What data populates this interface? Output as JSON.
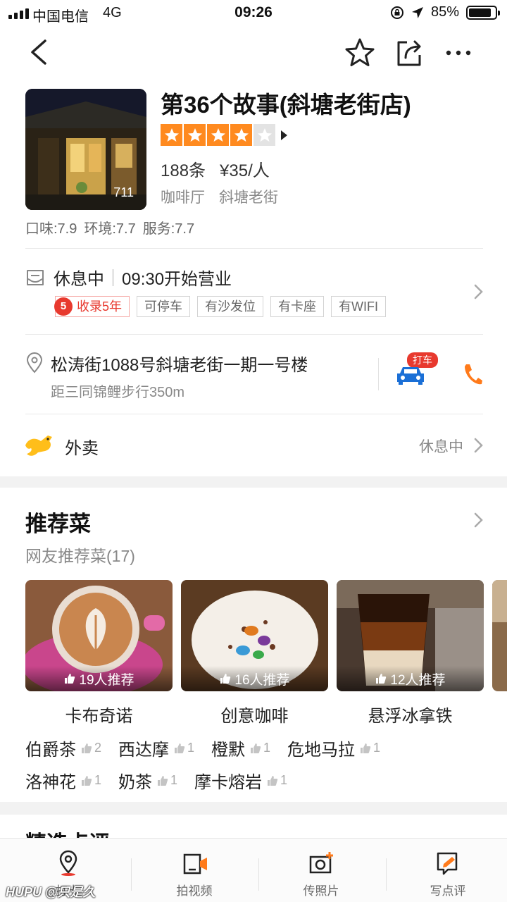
{
  "status_bar": {
    "carrier": "中国电信",
    "network": "4G",
    "time": "09:26",
    "battery": "85%",
    "battery_level": 0.85
  },
  "shop": {
    "name": "第36个故事(斜塘老街店)",
    "photo_count": "711",
    "rating_stars": 4,
    "reviews": "188条",
    "price": "¥35/人",
    "category": "咖啡厅",
    "area": "斜塘老街",
    "scores": [
      "口味:7.9",
      "环境:7.7",
      "服务:7.7"
    ]
  },
  "hours": {
    "status": "休息中",
    "open_info": "09:30开始营业",
    "badge_number": "5",
    "tags": [
      "收录5年",
      "可停车",
      "有沙发位",
      "有卡座",
      "有WIFI"
    ]
  },
  "address": {
    "text": "松涛街1088号斜塘老街一期一号楼",
    "distance": "距三同锦鲤步行350m",
    "taxi_label": "打车"
  },
  "delivery": {
    "label": "外卖",
    "status": "休息中"
  },
  "recommend": {
    "title": "推荐菜",
    "subtitle": "网友推荐菜(17)",
    "dishes": [
      {
        "name": "卡布奇诺",
        "likes": "19人推荐"
      },
      {
        "name": "创意咖啡",
        "likes": "16人推荐"
      },
      {
        "name": "悬浮冰拿铁",
        "likes": "12人推荐"
      }
    ],
    "extras_row1": [
      {
        "name": "伯爵茶",
        "count": "2"
      },
      {
        "name": "西达摩",
        "count": "1"
      },
      {
        "name": "橙默",
        "count": "1"
      },
      {
        "name": "危地马拉",
        "count": "1"
      }
    ],
    "extras_row2": [
      {
        "name": "洛神花",
        "count": "1"
      },
      {
        "name": "奶茶",
        "count": "1"
      },
      {
        "name": "摩卡熔岩",
        "count": "1"
      }
    ]
  },
  "next_section_title": "精选点评",
  "tabbar": {
    "checkin": "打卡",
    "video": "拍视频",
    "photo": "传照片",
    "review": "写点评"
  },
  "watermark": "HUPU @只是久",
  "colors": {
    "accent": "#ff8a1f",
    "red": "#e8392e",
    "taxi_blue": "#1a6fd6"
  }
}
